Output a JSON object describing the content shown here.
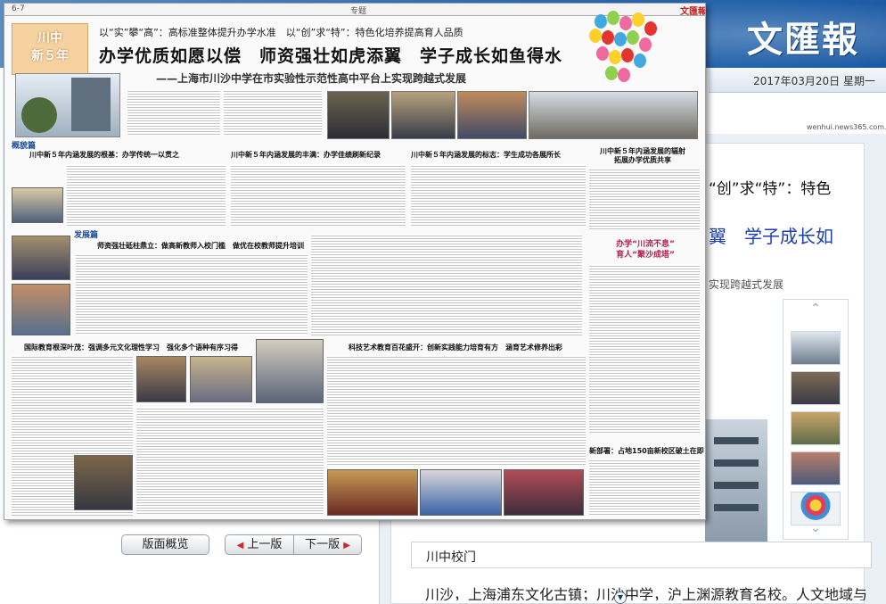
{
  "site": {
    "masthead": "文匯報",
    "date": "2017年03月20日 星期一",
    "site_tag": "wenhui.news365.com.cn"
  },
  "newspaper_page": {
    "page_number": "6-7",
    "section": "专题",
    "masthead": "文匯報",
    "badge": [
      "川中",
      "新５年"
    ],
    "supra_title": "以“实”攀“高”：高标准整体提升办学水准　以“创”求“特”：特色化培养提高育人品质",
    "main_title": "办学优质如愿以偿　师资强壮如虎添翼　学子成长如鱼得水",
    "sub_title": "——上海市川沙中学在市实验性示范性高中平台上实现跨越式发展",
    "section_labels": [
      "概貌篇",
      "发展篇"
    ],
    "headlines": [
      "川中新５年内涵发展的根基：办学传统一以贯之",
      "川中新５年内涵发展的丰满：办学佳绩刷新纪录",
      "川中新５年内涵发展的标志：学生成功各展所长",
      "川中新５年内涵发展的辐射",
      "拓展办学优质共享",
      "师资强壮砥柱鼎立：做高新教师入校门槛　做优在校教师提升培训",
      "国际教育根深叶茂：强调多元文化理性学习　强化多个语种有序习得",
      "科技艺术教育百花盛开：创新实践能力培育有方　涵育艺术修养出彩",
      "新部署：占地150亩新校区破土在即"
    ],
    "side_slogan": [
      "办学“川流不息”",
      "育人“聚沙成塔”"
    ]
  },
  "article_clip": {
    "line1": "“创”求“特”：特色",
    "line2": "翼　学子成长如",
    "line3": "实现跨越式发展"
  },
  "thumbnails": {
    "up_icon": "chevron-up-icon",
    "down_icon": "chevron-down-icon",
    "count": 5
  },
  "caption": "川中校门",
  "body_text": "川沙，上海浦东文化古镇；川沙中学，沪上渊源教育名校。人文地域与悠久",
  "nav": {
    "overview": "版面概览",
    "prev": "上一版",
    "next": "下一版"
  },
  "colors": {
    "band_blue": "#2f6fb5",
    "link_blue": "#1a3fb0",
    "arrow_red": "#d4242a"
  }
}
